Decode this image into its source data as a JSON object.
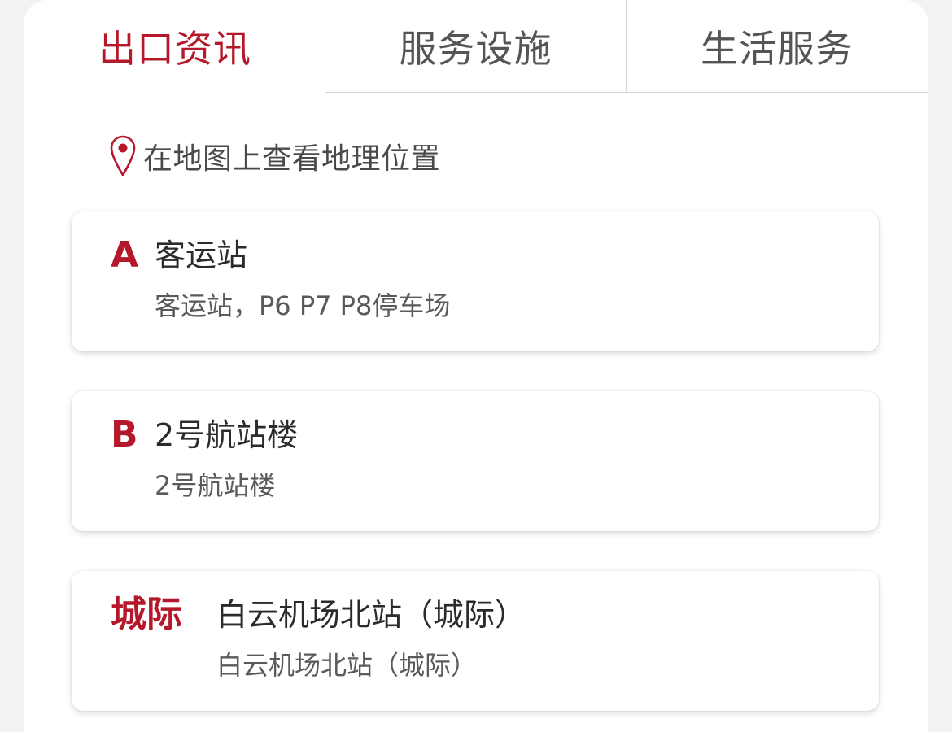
{
  "tabs": [
    {
      "label": "出口资讯",
      "active": true
    },
    {
      "label": "服务设施",
      "active": false
    },
    {
      "label": "生活服务",
      "active": false
    }
  ],
  "map_link": {
    "icon": "location-pin-icon",
    "label": "在地图上查看地理位置"
  },
  "exits": [
    {
      "badge": "A",
      "title": "客运站",
      "subtitle": "客运站，P6 P7 P8停车场"
    },
    {
      "badge": "B",
      "title": "2号航站楼",
      "subtitle": "2号航站楼"
    },
    {
      "badge": "城际",
      "title": "白云机场北站（城际）",
      "subtitle": "白云机场北站（城际）"
    }
  ],
  "colors": {
    "accent": "#b5182a",
    "tab_inactive_text": "#555555",
    "background": "#f2f2f4"
  }
}
